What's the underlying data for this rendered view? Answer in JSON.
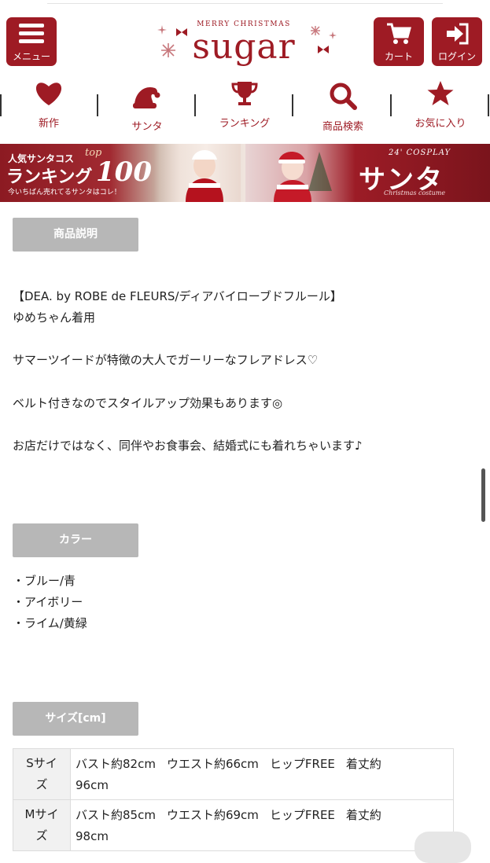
{
  "header": {
    "menu_label": "メニュー",
    "logo_tagline": "MERRY CHRISTMAS",
    "logo_word": "sugar",
    "cart_label": "カート",
    "login_label": "ログイン"
  },
  "nav": [
    {
      "label": "新作",
      "icon": "heart-icon"
    },
    {
      "label": "サンタ",
      "icon": "santa-hat-icon"
    },
    {
      "label": "ランキング",
      "icon": "trophy-icon"
    },
    {
      "label": "商品検索",
      "icon": "search-icon"
    },
    {
      "label": "お気に入り",
      "icon": "star-icon"
    }
  ],
  "banner": {
    "left_line1": "人気サンタコス",
    "left_line2": "ランキング",
    "left_top": "top",
    "left_number": "100",
    "left_line3": "今いちばん売れてるサンタはコレ！",
    "right_line1": "24' COSPLAY",
    "right_line2": "サンタ",
    "right_line3": "Christmas costume"
  },
  "sections": {
    "description": {
      "label": "商品説明",
      "lines": [
        "【DEA. by ROBE de FLEURS/ディアバイローブドフルール】",
        "ゆめちゃん着用",
        "サマーツイードが特徴の大人でガーリーなフレアドレス♡",
        "ベルト付きなのでスタイルアップ効果もあります◎",
        "お店だけではなく、同伴やお食事会、結婚式にも着れちゃいます♪"
      ]
    },
    "color": {
      "label": "カラー",
      "items": [
        "・ブルー/青",
        "・アイボリー",
        "・ライム/黄緑"
      ]
    },
    "size": {
      "label": "サイズ[cm]",
      "rows": [
        {
          "size_l1": "Sサイ",
          "size_l2": "ズ",
          "bust": "バスト約82cm",
          "waist": "ウエスト約66cm",
          "hip": "ヒップFREE",
          "len_label": "着丈約",
          "len_value": "96cm"
        },
        {
          "size_l1": "Mサイ",
          "size_l2": "ズ",
          "bust": "バスト約85cm",
          "waist": "ウエスト約69cm",
          "hip": "ヒップFREE",
          "len_label": "着丈約",
          "len_value": "98cm"
        }
      ]
    }
  },
  "colors": {
    "brand": "#9e1b24",
    "section_label_bg": "#b7b7b7",
    "table_header_bg": "#f1f1f1"
  }
}
